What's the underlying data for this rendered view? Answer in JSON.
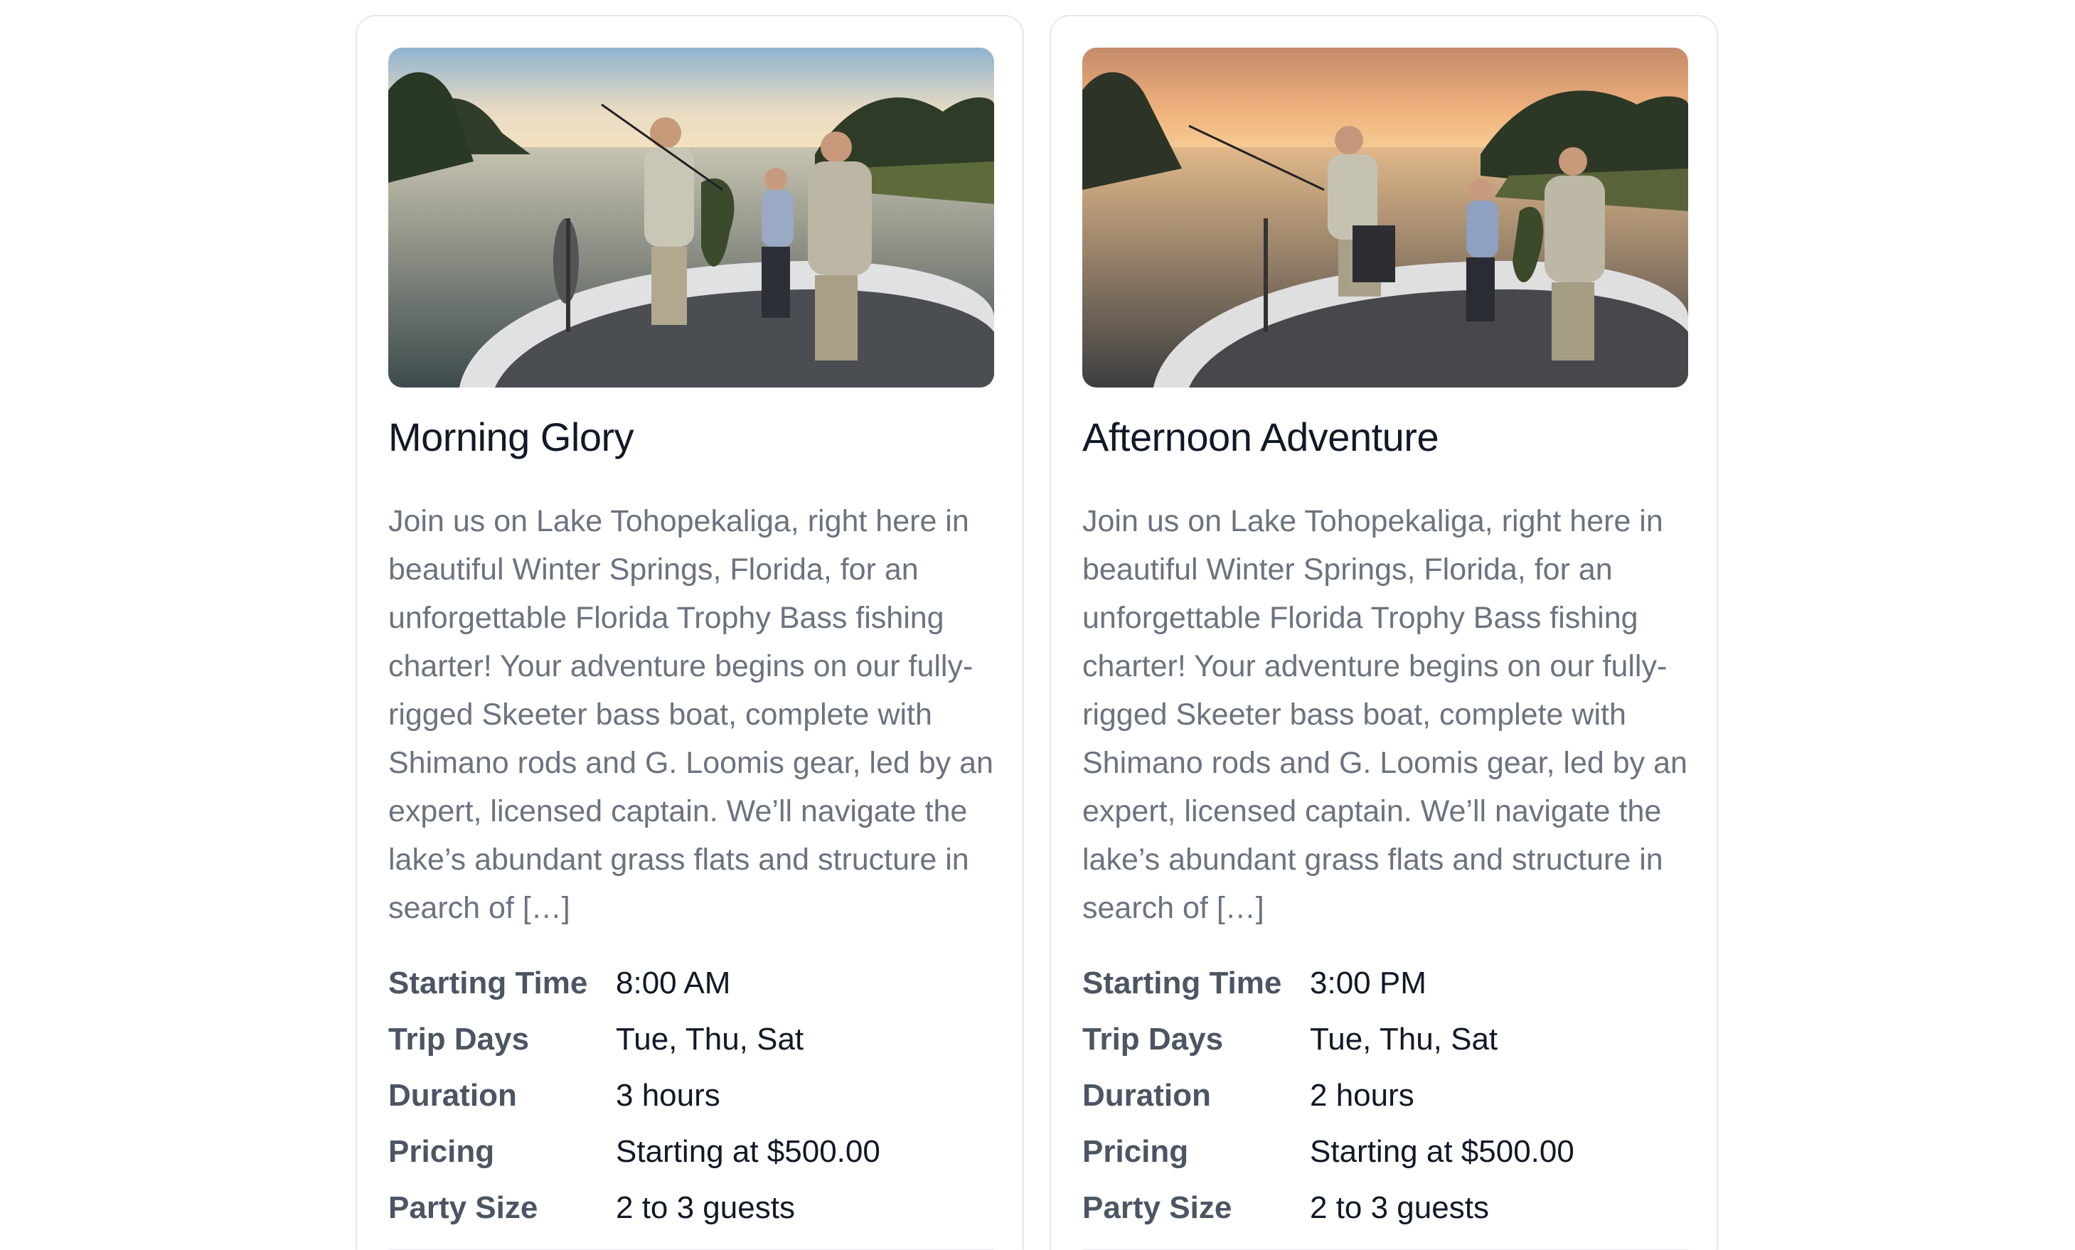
{
  "cards": [
    {
      "title": "Morning Glory",
      "description": "Join us on Lake Tohopekaliga, right here in beautiful Winter Springs, Florida, for an unforgettable Florida Trophy Bass fishing charter! Your adventure begins on our fully-rigged Skeeter bass boat, complete with Shimano rods and G. Loomis gear, led by an expert, licensed captain. We’ll navigate the lake’s abundant grass flats and structure in search of […]",
      "details": [
        {
          "label": "Starting Time",
          "value": "8:00 AM"
        },
        {
          "label": "Trip Days",
          "value": "Tue, Thu, Sat"
        },
        {
          "label": "Duration",
          "value": "3 hours"
        },
        {
          "label": "Pricing",
          "value": "Starting at $500.00"
        },
        {
          "label": "Party Size",
          "value": "2 to 3 guests"
        }
      ]
    },
    {
      "title": "Afternoon Adventure",
      "description": "Join us on Lake Tohopekaliga, right here in beautiful Winter Springs, Florida, for an unforgettable Florida Trophy Bass fishing charter! Your adventure begins on our fully-rigged Skeeter bass boat, complete with Shimano rods and G. Loomis gear, led by an expert, licensed captain. We’ll navigate the lake’s abundant grass flats and structure in search of […]",
      "details": [
        {
          "label": "Starting Time",
          "value": "3:00 PM"
        },
        {
          "label": "Trip Days",
          "value": "Tue, Thu, Sat"
        },
        {
          "label": "Duration",
          "value": "2 hours"
        },
        {
          "label": "Pricing",
          "value": "Starting at $500.00"
        },
        {
          "label": "Party Size",
          "value": "2 to 3 guests"
        }
      ]
    }
  ],
  "colors": {
    "card_border": "#e5e7eb",
    "title": "#111827",
    "description": "#6b7280",
    "detail_label": "#4b5563",
    "detail_value": "#111827"
  }
}
